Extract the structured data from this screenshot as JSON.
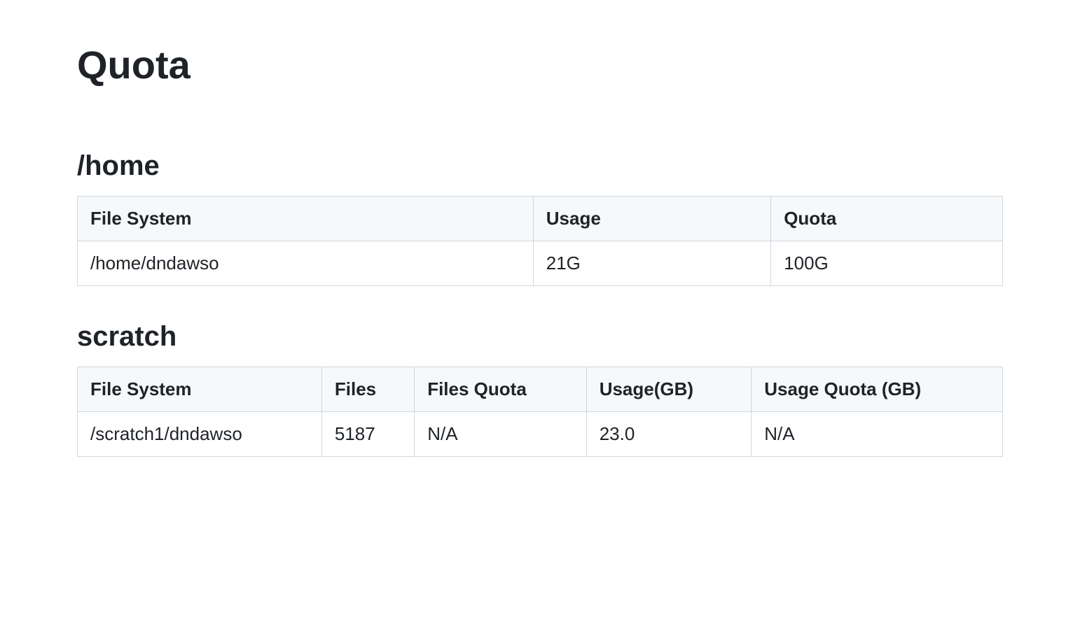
{
  "page_title": "Quota",
  "sections": {
    "home": {
      "heading": "/home",
      "headers": [
        "File System",
        "Usage",
        "Quota"
      ],
      "rows": [
        {
          "file_system": "/home/dndawso",
          "usage": "21G",
          "quota": "100G"
        }
      ]
    },
    "scratch": {
      "heading": "scratch",
      "headers": [
        "File System",
        "Files",
        "Files Quota",
        "Usage(GB)",
        "Usage Quota (GB)"
      ],
      "rows": [
        {
          "file_system": "/scratch1/dndawso",
          "files": "5187",
          "files_quota": "N/A",
          "usage_gb": "23.0",
          "usage_quota_gb": "N/A"
        }
      ]
    }
  }
}
